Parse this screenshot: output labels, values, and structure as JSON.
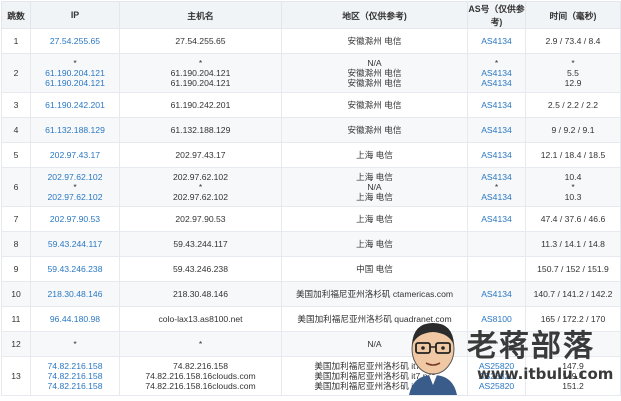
{
  "headers": {
    "index": "跳数",
    "ip": "IP",
    "hostname": "主机名",
    "region": "地区（仅供参考)",
    "as": "AS号（仅供参考)",
    "time": "时间（毫秒)"
  },
  "rows": [
    {
      "idx": "1",
      "ip": [
        "27.54.255.65"
      ],
      "host": [
        "27.54.255.65"
      ],
      "loc": [
        "安徽滁州 电信"
      ],
      "as": [
        "AS4134"
      ],
      "time": [
        "2.9 / 73.4 / 8.4"
      ]
    },
    {
      "idx": "2",
      "ip": [
        "*",
        "61.190.204.121",
        "61.190.204.121"
      ],
      "host": [
        "*",
        "61.190.204.121",
        "61.190.204.121"
      ],
      "loc": [
        "N/A",
        "安徽滁州 电信",
        "安徽滁州 电信"
      ],
      "as": [
        "*",
        "AS4134",
        "AS4134"
      ],
      "time": [
        "*",
        "5.5",
        "12.9"
      ]
    },
    {
      "idx": "3",
      "ip": [
        "61.190.242.201"
      ],
      "host": [
        "61.190.242.201"
      ],
      "loc": [
        "安徽滁州 电信"
      ],
      "as": [
        "AS4134"
      ],
      "time": [
        "2.5 / 2.2 / 2.2"
      ]
    },
    {
      "idx": "4",
      "ip": [
        "61.132.188.129"
      ],
      "host": [
        "61.132.188.129"
      ],
      "loc": [
        "安徽滁州 电信"
      ],
      "as": [
        "AS4134"
      ],
      "time": [
        "9 / 9.2 / 9.1"
      ]
    },
    {
      "idx": "5",
      "ip": [
        "202.97.43.17"
      ],
      "host": [
        "202.97.43.17"
      ],
      "loc": [
        "上海 电信"
      ],
      "as": [
        "AS4134"
      ],
      "time": [
        "12.1 / 18.4 / 18.5"
      ]
    },
    {
      "idx": "6",
      "ip": [
        "202.97.62.102",
        "*",
        "202.97.62.102"
      ],
      "host": [
        "202.97.62.102",
        "*",
        "202.97.62.102"
      ],
      "loc": [
        "上海 电信",
        "N/A",
        "上海 电信"
      ],
      "as": [
        "AS4134",
        "*",
        "AS4134"
      ],
      "time": [
        "10.4",
        "*",
        "10.3"
      ]
    },
    {
      "idx": "7",
      "ip": [
        "202.97.90.53"
      ],
      "host": [
        "202.97.90.53"
      ],
      "loc": [
        "上海 电信"
      ],
      "as": [
        "AS4134"
      ],
      "time": [
        "47.4 / 37.6 / 46.6"
      ]
    },
    {
      "idx": "8",
      "ip": [
        "59.43.244.117"
      ],
      "host": [
        "59.43.244.117"
      ],
      "loc": [
        "上海 电信"
      ],
      "as": [
        ""
      ],
      "time": [
        "11.3 / 14.1 / 14.8"
      ]
    },
    {
      "idx": "9",
      "ip": [
        "59.43.246.238"
      ],
      "host": [
        "59.43.246.238"
      ],
      "loc": [
        "中国 电信"
      ],
      "as": [
        ""
      ],
      "time": [
        "150.7 / 152 / 151.9"
      ]
    },
    {
      "idx": "10",
      "ip": [
        "218.30.48.146"
      ],
      "host": [
        "218.30.48.146"
      ],
      "loc": [
        "美国加利福尼亚州洛杉矶 ctamericas.com"
      ],
      "as": [
        "AS4134"
      ],
      "time": [
        "140.7 / 141.2 / 142.2"
      ]
    },
    {
      "idx": "11",
      "ip": [
        "96.44.180.98"
      ],
      "host": [
        "colo-lax13.as8100.net"
      ],
      "loc": [
        "美国加利福尼亚州洛杉矶 quadranet.com"
      ],
      "as": [
        "AS8100"
      ],
      "time": [
        "165 / 172.2 / 170"
      ]
    },
    {
      "idx": "12",
      "ip": [
        "*"
      ],
      "host": [
        "*"
      ],
      "loc": [
        "N/A"
      ],
      "as": [
        "*"
      ],
      "time": [
        "*"
      ]
    },
    {
      "idx": "13",
      "ip": [
        "74.82.216.158",
        "74.82.216.158",
        "74.82.216.158"
      ],
      "host": [
        "74.82.216.158",
        "74.82.216.158.16clouds.com",
        "74.82.216.158.16clouds.com"
      ],
      "loc": [
        "美国加利福尼亚州洛杉矶 it7.net",
        "美国加利福尼亚州洛杉矶 it7.net",
        "美国加利福尼亚州洛杉矶 it7.net"
      ],
      "as": [
        "AS25820",
        "AS25820",
        "AS25820"
      ],
      "time": [
        "147.9",
        "149.4",
        "151.2"
      ]
    }
  ],
  "watermark": {
    "title": "老蒋部落",
    "url": "www.itbulu.com"
  },
  "colors": {
    "link": "#2a78c3",
    "header_bg": "#f1f4f7",
    "row_alt_bg": "#f7f8fa",
    "border": "#e6e9ee"
  }
}
